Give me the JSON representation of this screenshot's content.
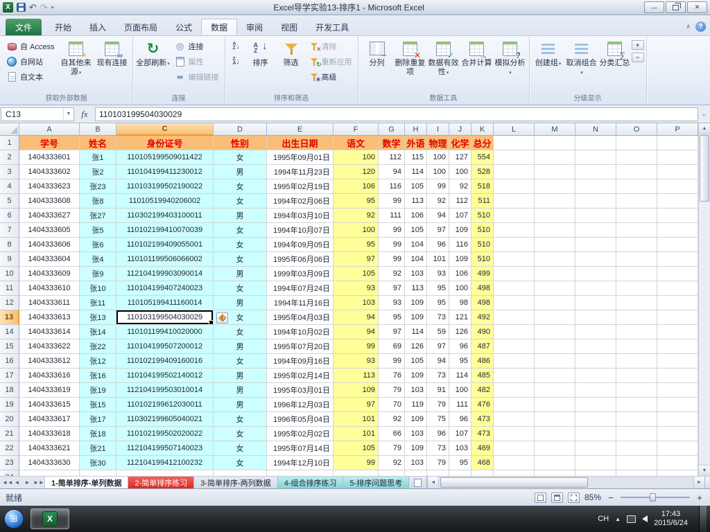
{
  "title_bar": {
    "title": "Excel导学实验13-排序1 - Microsoft Excel"
  },
  "ribbon": {
    "file_tab": "文件",
    "tabs": [
      "开始",
      "插入",
      "页面布局",
      "公式",
      "数据",
      "审阅",
      "视图",
      "开发工具"
    ],
    "active_tab": "数据",
    "get_external": {
      "label": "获取外部数据",
      "from_access": "自 Access",
      "from_web": "自网站",
      "from_text": "自文本",
      "other_sources": "自其他来源",
      "existing_connections": "现有连接"
    },
    "connections": {
      "label": "连接",
      "refresh_all": "全部刷新",
      "connections": "连接",
      "properties": "属性",
      "edit_links": "编辑链接"
    },
    "sort_filter": {
      "label": "排序和筛选",
      "sort": "排序",
      "filter": "筛选",
      "clear": "清除",
      "reapply": "重新应用",
      "advanced": "高级"
    },
    "data_tools": {
      "label": "数据工具",
      "text_to_columns": "分列",
      "remove_duplicates": "删除重复项",
      "data_validation": "数据有效性",
      "consolidate": "合并计算",
      "what_if": "模拟分析"
    },
    "outline": {
      "label": "分级显示",
      "group": "创建组",
      "ungroup": "取消组合",
      "subtotal": "分类汇总"
    }
  },
  "formula_bar": {
    "name_box": "C13",
    "fx_label": "fx",
    "value": "110103199504030029"
  },
  "sheet": {
    "columns": [
      "A",
      "B",
      "C",
      "D",
      "E",
      "F",
      "G",
      "H",
      "I",
      "J",
      "K",
      "L",
      "M",
      "N",
      "O",
      "P"
    ],
    "selected": {
      "cell": "C13",
      "column": "C",
      "row": 13
    },
    "table": {
      "headers": [
        "学号",
        "姓名",
        "身份证号",
        "性别",
        "出生日期",
        "语文",
        "数学",
        "外语",
        "物理",
        "化学",
        "总分"
      ],
      "rows": [
        [
          "1404333601",
          "张1",
          "110105199509011422",
          "女",
          "1995年09月01日",
          100,
          112,
          115,
          100,
          127,
          554
        ],
        [
          "1404333602",
          "张2",
          "110104199411230012",
          "男",
          "1994年11月23日",
          120,
          94,
          114,
          100,
          100,
          528
        ],
        [
          "1404333623",
          "张23",
          "110103199502190022",
          "女",
          "1995年02月19日",
          106,
          116,
          105,
          99,
          92,
          518
        ],
        [
          "1404333608",
          "张8",
          "11010519940206002",
          "女",
          "1994年02月06日",
          95,
          99,
          113,
          92,
          112,
          511
        ],
        [
          "1404333627",
          "张27",
          "110302199403100011",
          "男",
          "1994年03月10日",
          92,
          111,
          106,
          94,
          107,
          510
        ],
        [
          "1404333605",
          "张5",
          "110102199410070039",
          "女",
          "1994年10月07日",
          100,
          99,
          105,
          97,
          109,
          510
        ],
        [
          "1404333606",
          "张6",
          "110102199409055001",
          "女",
          "1994年09月05日",
          95,
          99,
          104,
          96,
          116,
          510
        ],
        [
          "1404333604",
          "张4",
          "110101199506066002",
          "女",
          "1995年06月06日",
          97,
          99,
          104,
          101,
          109,
          510
        ],
        [
          "1404333609",
          "张9",
          "112104199903090014",
          "男",
          "1999年03月09日",
          105,
          92,
          103,
          93,
          106,
          499
        ],
        [
          "1404333610",
          "张10",
          "110104199407240023",
          "女",
          "1994年07月24日",
          93,
          97,
          113,
          95,
          100,
          498
        ],
        [
          "1404333611",
          "张11",
          "110105199411160014",
          "男",
          "1994年11月16日",
          103,
          93,
          109,
          95,
          98,
          498
        ],
        [
          "1404333613",
          "张13",
          "110103199504030029",
          "女",
          "1995年04月03日",
          94,
          95,
          109,
          73,
          121,
          492
        ],
        [
          "1404333614",
          "张14",
          "110101199410020000",
          "女",
          "1994年10月02日",
          94,
          97,
          114,
          59,
          126,
          490
        ],
        [
          "1404333622",
          "张22",
          "110104199507200012",
          "男",
          "1995年07月20日",
          99,
          69,
          126,
          97,
          96,
          487
        ],
        [
          "1404333612",
          "张12",
          "110102199409160016",
          "女",
          "1994年09月16日",
          93,
          99,
          105,
          94,
          95,
          486
        ],
        [
          "1404333616",
          "张16",
          "110104199502140012",
          "男",
          "1995年02月14日",
          113,
          76,
          109,
          73,
          114,
          485
        ],
        [
          "1404333619",
          "张19",
          "112104199503010014",
          "男",
          "1995年03月01日",
          109,
          79,
          103,
          91,
          100,
          482
        ],
        [
          "1404333615",
          "张15",
          "110102199612030011",
          "男",
          "1996年12月03日",
          97,
          70,
          119,
          79,
          111,
          476
        ],
        [
          "1404333617",
          "张17",
          "110302199605040021",
          "女",
          "1996年05月04日",
          101,
          92,
          109,
          75,
          96,
          473
        ],
        [
          "1404333618",
          "张18",
          "110102199502020022",
          "女",
          "1995年02月02日",
          101,
          66,
          103,
          96,
          107,
          473
        ],
        [
          "1404333621",
          "张21",
          "112104199507140023",
          "女",
          "1995年07月14日",
          105,
          79,
          109,
          73,
          103,
          469
        ],
        [
          "1404333630",
          "张30",
          "112104199412100232",
          "女",
          "1994年12月10日",
          99,
          92,
          103,
          79,
          95,
          468
        ]
      ]
    }
  },
  "sheet_tabs": {
    "tabs": [
      {
        "label": "1-简单排序-单列数据",
        "state": "active"
      },
      {
        "label": "2-简单排序练习",
        "state": "red"
      },
      {
        "label": "3-简单排序-两列数据",
        "state": "normal"
      },
      {
        "label": "4-组合排序练习",
        "state": "cyan"
      },
      {
        "label": "5-排序问题思考",
        "state": "cyan"
      }
    ]
  },
  "status_bar": {
    "mode": "就绪",
    "zoom": "85%"
  },
  "taskbar": {
    "language": "CH",
    "time": "17:43",
    "date": "2015/6/24"
  }
}
